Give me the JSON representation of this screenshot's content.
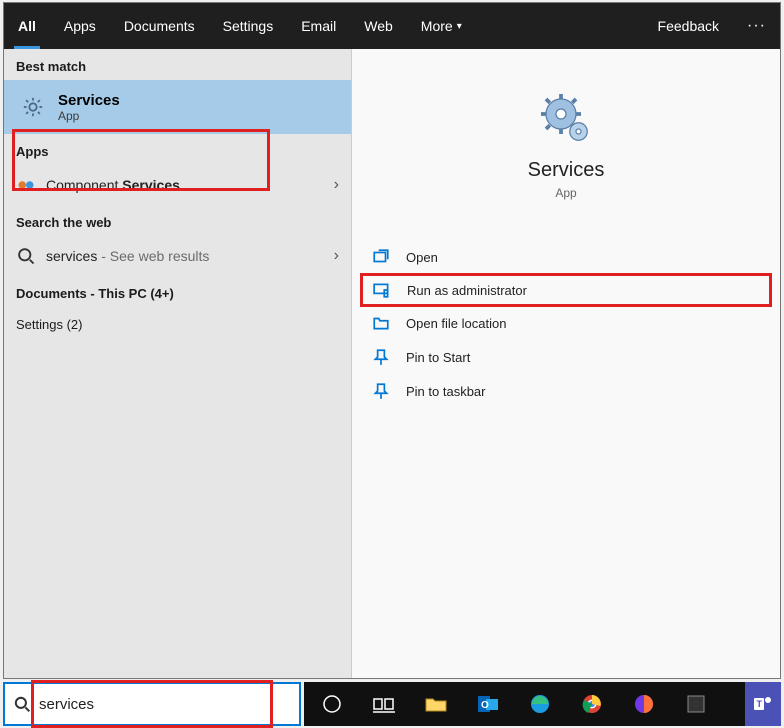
{
  "tabs": {
    "all": "All",
    "apps": "Apps",
    "documents": "Documents",
    "settings": "Settings",
    "email": "Email",
    "web": "Web",
    "more": "More",
    "feedback": "Feedback"
  },
  "sections": {
    "best_match": "Best match",
    "apps": "Apps",
    "search_web": "Search the web",
    "documents": "Documents - This PC (4+)",
    "settings": "Settings (2)"
  },
  "best_match": {
    "title": "Services",
    "subtitle": "App"
  },
  "apps_results": {
    "component_prefix": "Component ",
    "component_bold": "Services"
  },
  "web_results": {
    "query": "services",
    "suffix": " - See web results"
  },
  "detail": {
    "title": "Services",
    "subtitle": "App",
    "actions": {
      "open": "Open",
      "run_admin": "Run as administrator",
      "open_location": "Open file location",
      "pin_start": "Pin to Start",
      "pin_taskbar": "Pin to taskbar"
    }
  },
  "search_box": {
    "value": "services"
  },
  "colors": {
    "accent": "#0078d4",
    "highlight_red": "#e02020",
    "selected_bg": "#a6cbe9"
  }
}
